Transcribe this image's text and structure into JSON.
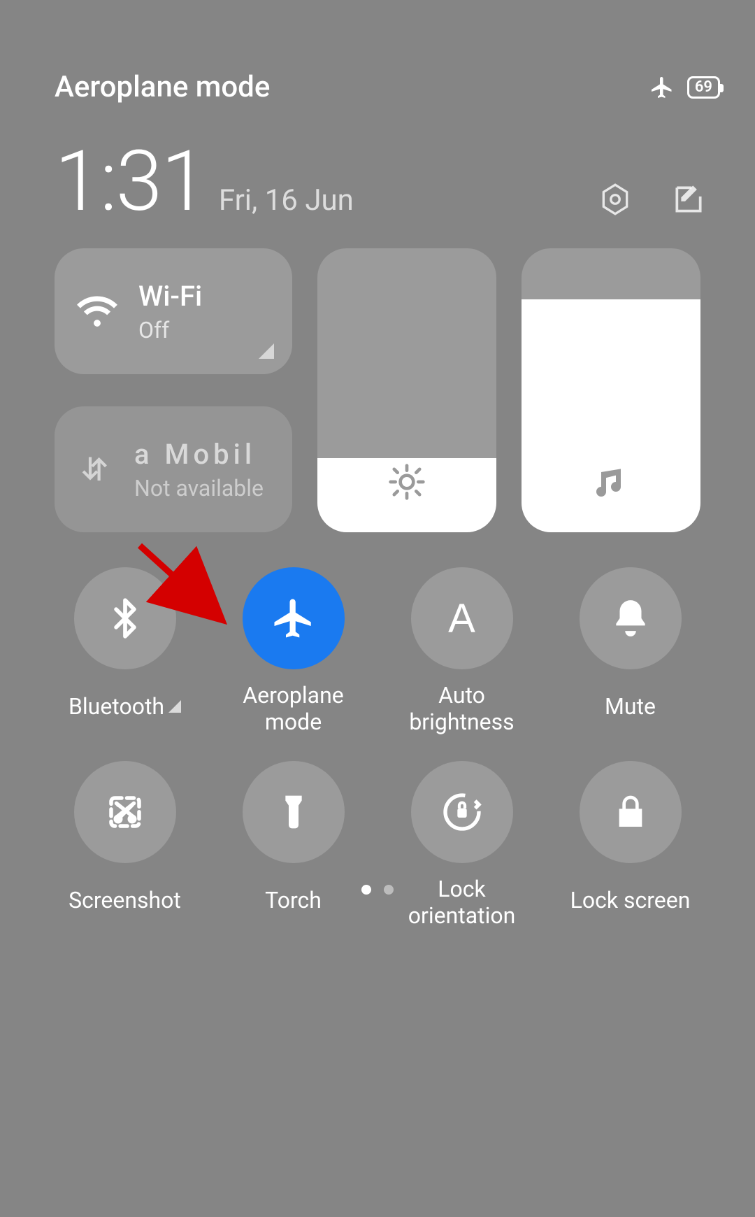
{
  "status": {
    "title": "Aeroplane mode",
    "battery": "69"
  },
  "clock": {
    "time": "1:31",
    "date": "Fri, 16 Jun"
  },
  "wifi": {
    "title": "Wi-Fi",
    "status": "Off"
  },
  "mobile": {
    "title": "a     Mobil",
    "status": "Not available"
  },
  "sliders": {
    "brightness_pct": 26,
    "volume_pct": 82
  },
  "toggles": [
    {
      "id": "bluetooth",
      "label": "Bluetooth",
      "active": false,
      "icon": "bluetooth-icon",
      "expandable": true
    },
    {
      "id": "airplane",
      "label": "Aeroplane mode",
      "active": true,
      "icon": "airplane-icon"
    },
    {
      "id": "autobrightness",
      "label": "Auto brightness",
      "active": false,
      "icon": "auto-brightness-icon"
    },
    {
      "id": "mute",
      "label": "Mute",
      "active": false,
      "icon": "bell-icon"
    },
    {
      "id": "screenshot",
      "label": "Screenshot",
      "active": false,
      "icon": "screenshot-icon"
    },
    {
      "id": "torch",
      "label": "Torch",
      "active": false,
      "icon": "torch-icon"
    },
    {
      "id": "lockorientation",
      "label": "Lock orientation",
      "active": false,
      "icon": "lock-orientation-icon"
    },
    {
      "id": "lockscreen",
      "label": "Lock screen",
      "active": false,
      "icon": "lock-icon"
    }
  ],
  "pager": {
    "pages": 2,
    "current": 0
  },
  "annotation": {
    "arrow_target": "airplane-toggle",
    "color": "#d40000"
  }
}
